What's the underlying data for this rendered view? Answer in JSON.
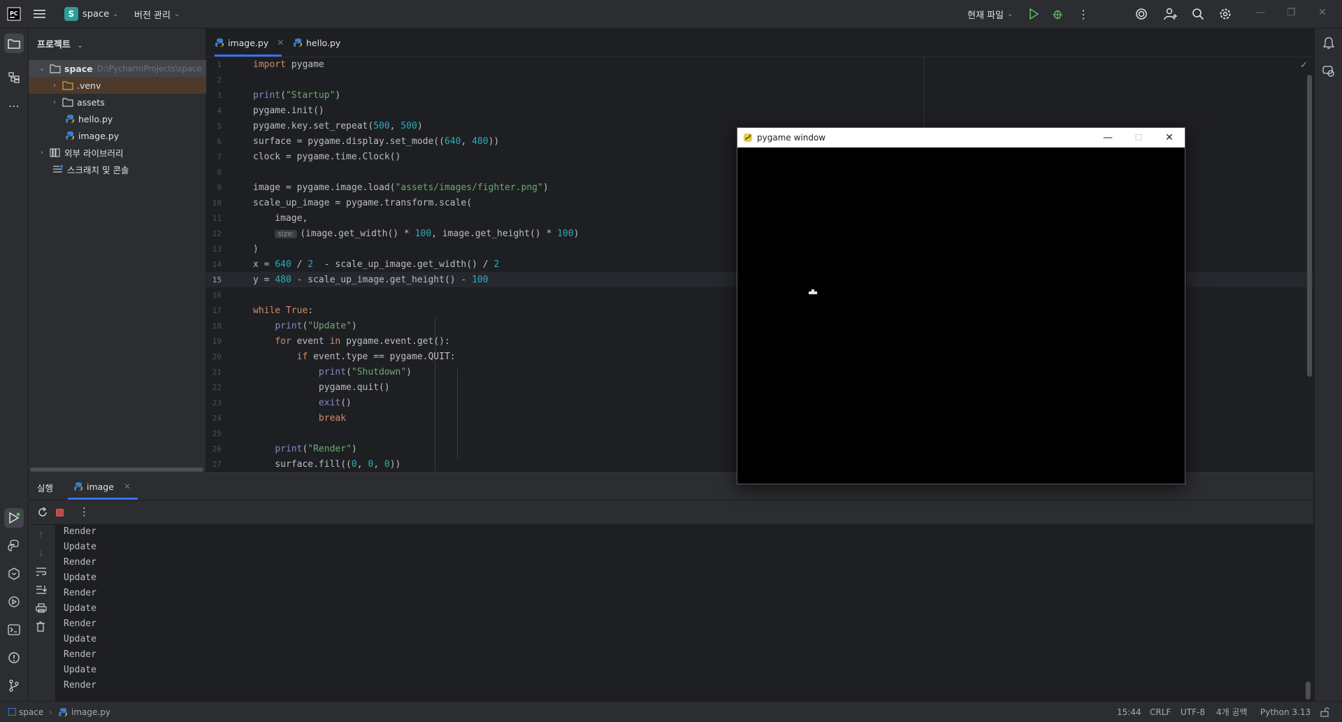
{
  "titlebar": {
    "project_badge": "S",
    "project_name": "space",
    "vcs_label": "버전 관리",
    "run_config": "현재 파일",
    "icons": [
      "app-logo-icon",
      "hamburger-menu-icon",
      "run-icon",
      "debug-icon",
      "more-vertical-icon",
      "ai-assistant-icon",
      "add-user-icon",
      "search-icon",
      "settings-icon",
      "minimize-icon",
      "restore-icon",
      "close-icon"
    ]
  },
  "project_panel": {
    "title": "프로젝트",
    "tree": [
      {
        "label": "space",
        "path": "D:\\PycharmProjects\\space",
        "type": "folder",
        "expanded": true
      },
      {
        "label": ".venv",
        "type": "folder",
        "expanded": false
      },
      {
        "label": "assets",
        "type": "folder",
        "expanded": false
      },
      {
        "label": "hello.py",
        "type": "python-file"
      },
      {
        "label": "image.py",
        "type": "python-file"
      },
      {
        "label": "외부 라이브러리",
        "type": "library"
      },
      {
        "label": "스크래치 및 콘솔",
        "type": "scratch"
      }
    ]
  },
  "editor": {
    "tabs": [
      {
        "label": "image.py",
        "active": true
      },
      {
        "label": "hello.py",
        "active": false
      }
    ],
    "current_line": 15,
    "line_numbers": [
      "1",
      "2",
      "3",
      "4",
      "5",
      "6",
      "7",
      "8",
      "9",
      "10",
      "11",
      "12",
      "13",
      "14",
      "15",
      "16",
      "17",
      "18",
      "19",
      "20",
      "21",
      "22",
      "23",
      "24",
      "25",
      "26",
      "27"
    ],
    "param_hint": "size:"
  },
  "run_panel": {
    "title": "실행",
    "tab_label": "image",
    "output": [
      "Render",
      "Update",
      "Render",
      "Update",
      "Render",
      "Update",
      "Render",
      "Update",
      "Render",
      "Update",
      "Render"
    ]
  },
  "statusbar": {
    "breadcrumb_project": "space",
    "breadcrumb_file": "image.py",
    "position": "15:44",
    "line_separator": "CRLF",
    "encoding": "UTF-8",
    "indent": "4개 공백",
    "interpreter": "Python 3.13"
  },
  "pygame_window": {
    "title": "pygame window"
  }
}
